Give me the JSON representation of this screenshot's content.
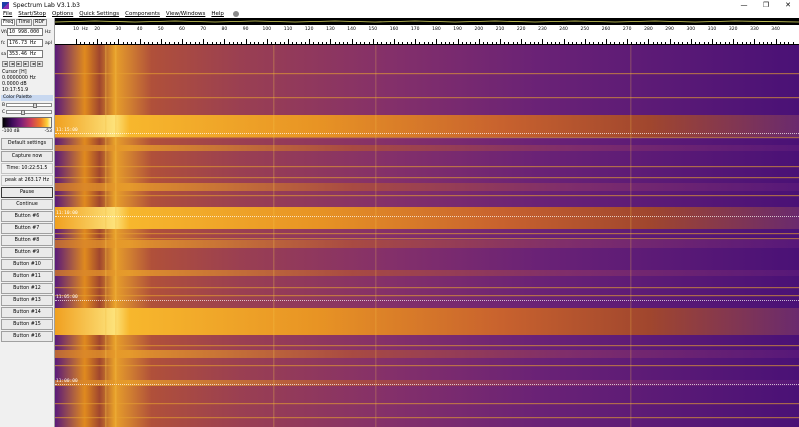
{
  "window": {
    "title": "Spectrum Lab V3.1.b3",
    "controls": [
      "—",
      "❐",
      "✕"
    ]
  },
  "menu": [
    "File",
    "Start/Stop",
    "Options",
    "Quick Settings",
    "Components",
    "View/Windows",
    "Help"
  ],
  "left_panel": {
    "tabs": [
      "Freq",
      "Time",
      "RDF"
    ],
    "fields": [
      {
        "label": "Vfo",
        "value": "10 998.000",
        "unit": "Hz"
      },
      {
        "label": "fc",
        "value": "176.73 Hz",
        "unit": "apl"
      },
      {
        "label": "sa",
        "value": "353.46 Hz",
        "unit": ""
      }
    ],
    "arrows": [
      "◄",
      "◄",
      "►",
      "►",
      "◄",
      "►"
    ],
    "cursor": {
      "title": "Cursor [H]",
      "freq": "0.0000000 Hz",
      "level": "0.0000 dB",
      "time": "10:17:51.9"
    },
    "palette": {
      "label": "Color Palette",
      "b_label": "B",
      "c_label": "C",
      "min": "-100 dB",
      "max": "-53"
    },
    "buttons": {
      "default_settings": "Default settings",
      "capture_now": "Capture now",
      "time": "Time: 10:22:51.5",
      "peak": "peak at 263.17 Hz",
      "pause": "Pause",
      "continue": "Continue",
      "numbered": [
        "Button #6",
        "Button #7",
        "Button #8",
        "Button #9",
        "Button #10",
        "Button #11",
        "Button #12",
        "Button #13",
        "Button #14",
        "Button #15",
        "Button #16"
      ]
    }
  },
  "frequency_scale": {
    "unit": "Hz",
    "labels": [
      "10",
      "20",
      "30",
      "40",
      "50",
      "60",
      "70",
      "80",
      "90",
      "100",
      "110",
      "120",
      "130",
      "140",
      "150",
      "160",
      "170",
      "180",
      "190",
      "200",
      "210",
      "220",
      "230",
      "240",
      "250",
      "260",
      "270",
      "280",
      "290",
      "300",
      "310",
      "320",
      "330",
      "340"
    ]
  },
  "waterfall": {
    "time_markers": [
      "11:15:00",
      "11:10:00",
      "11:05:00",
      "11:00:00"
    ]
  }
}
